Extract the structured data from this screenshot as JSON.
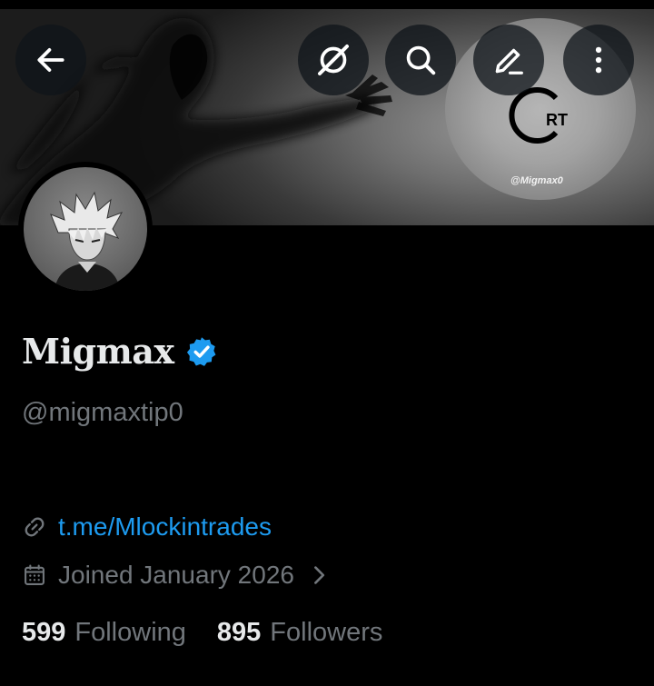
{
  "header": {
    "banner_watermark_text": "RT",
    "banner_watermark_handle": "@Migmax0",
    "buttons": [
      {
        "name": "back-button",
        "icon": "arrow-left-icon"
      },
      {
        "name": "grok-button",
        "icon": "grok-slash-icon"
      },
      {
        "name": "search-button",
        "icon": "search-icon"
      },
      {
        "name": "edit-button",
        "icon": "pencil-icon"
      },
      {
        "name": "more-button",
        "icon": "more-vertical-icon"
      }
    ]
  },
  "profile": {
    "display_name": "Migmax",
    "verified": true,
    "verified_color": "#1d9bf0",
    "handle": "@migmaxtip0",
    "link": "t.me/Mlockintrades",
    "joined": "Joined January 2026",
    "following_count": "599",
    "following_label": "Following",
    "followers_count": "895",
    "followers_label": "Followers"
  },
  "colors": {
    "background": "#000000",
    "primary_text": "#e7e9ea",
    "secondary_text": "#71767b",
    "accent": "#1d9bf0"
  }
}
